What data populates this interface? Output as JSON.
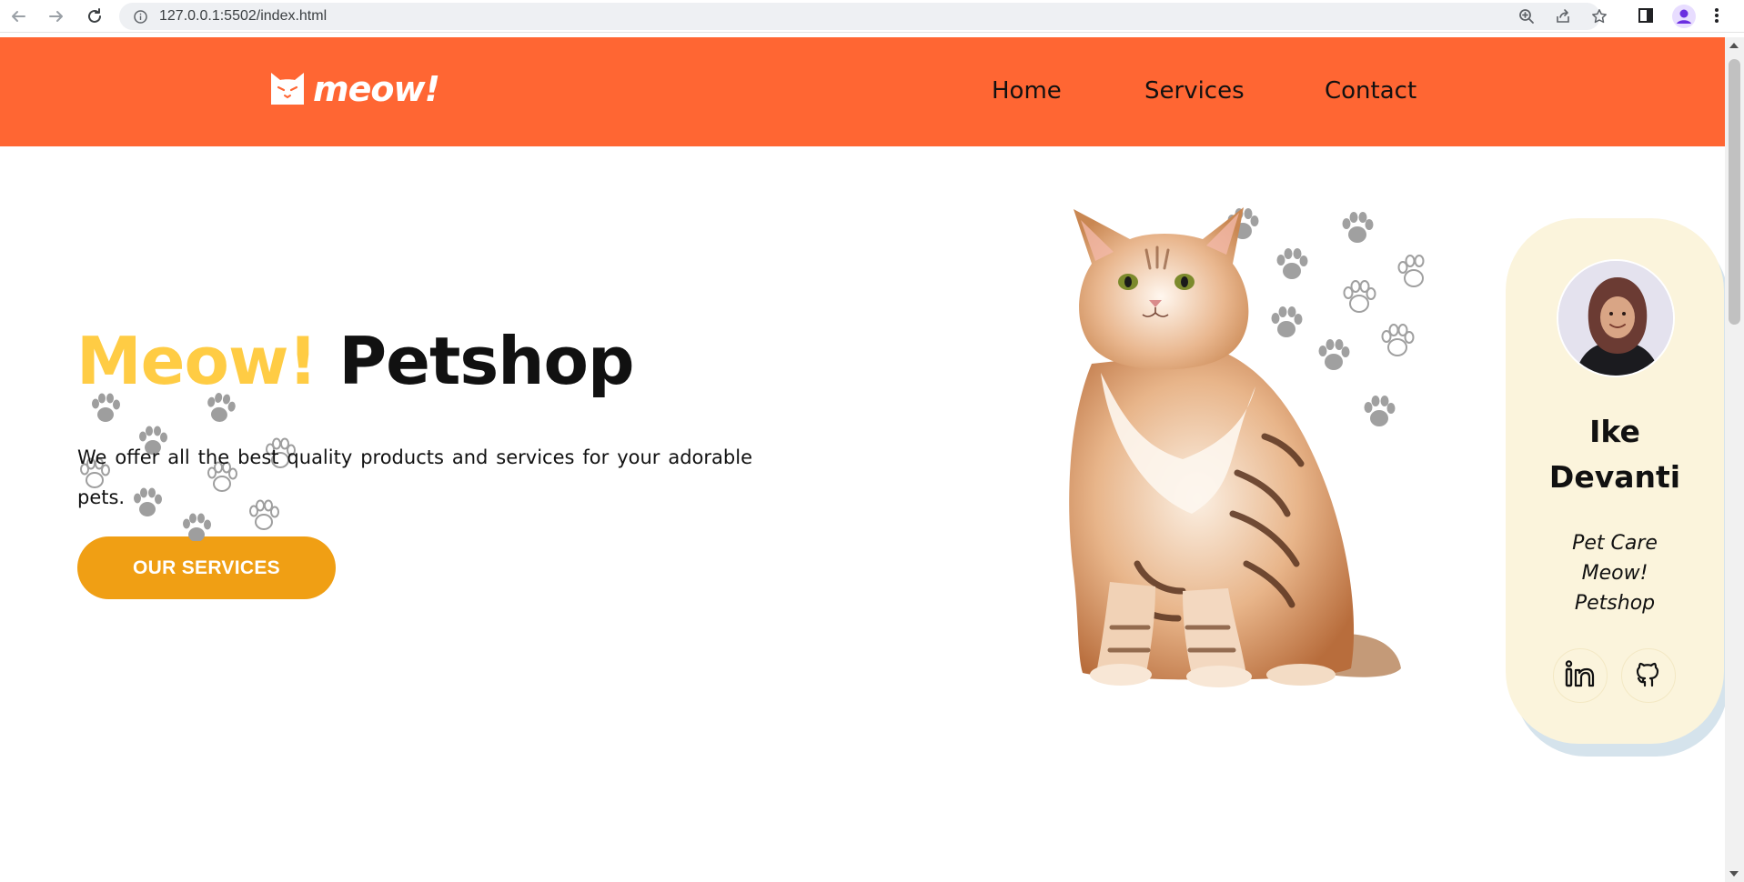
{
  "browser": {
    "url": "127.0.0.1:5502/index.html"
  },
  "header": {
    "logo_text": "meow!",
    "nav": [
      {
        "label": "Home"
      },
      {
        "label": "Services"
      },
      {
        "label": "Contact"
      }
    ]
  },
  "hero": {
    "title_accent": "Meow!",
    "title_main": "Petshop",
    "description": "We offer all the best quality products and services for your adorable pets.",
    "cta_label": "OUR SERVICES"
  },
  "profile": {
    "name_first": "Ike",
    "name_last": "Devanti",
    "role_line1": "Pet Care",
    "role_line2": "Meow!",
    "role_line3": "Petshop"
  },
  "colors": {
    "header_bg": "#ff6633",
    "accent_yellow": "#ffcc44",
    "cta_orange": "#f09f14",
    "card_bg": "#fbf4dc"
  },
  "icons": [
    "back-arrow-icon",
    "forward-arrow-icon",
    "reload-icon",
    "info-icon",
    "zoom-icon",
    "share-icon",
    "star-icon",
    "side-panel-icon",
    "profile-icon",
    "kebab-menu-icon",
    "cat-logo-icon",
    "paw-icon",
    "linkedin-icon",
    "github-icon"
  ]
}
